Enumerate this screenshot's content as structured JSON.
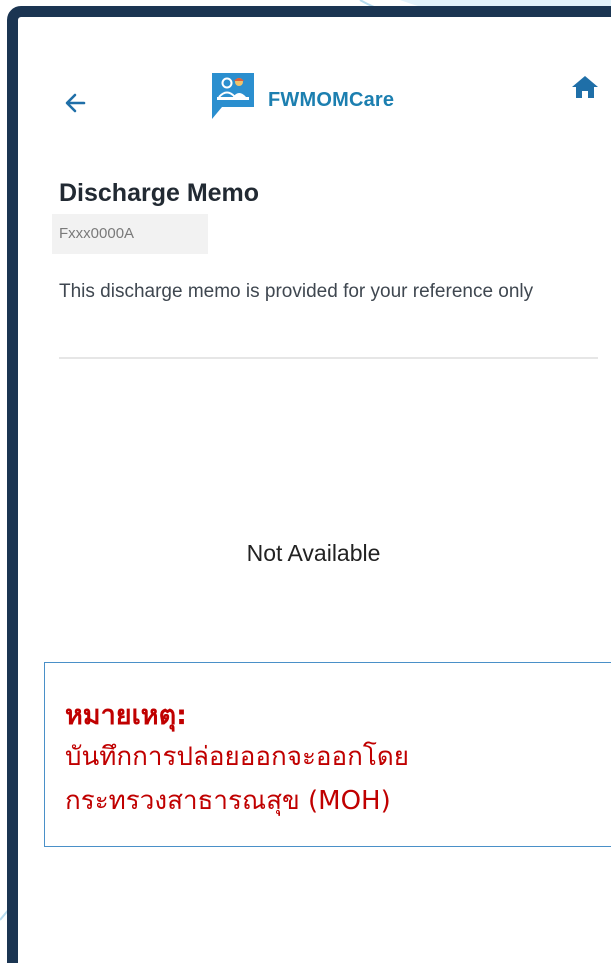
{
  "header": {
    "back_icon": "arrow-left-icon",
    "brand_name": "FWMOMCare",
    "home_icon": "home-icon"
  },
  "page": {
    "title": "Discharge Memo",
    "id_value": "Fxxx0000A",
    "info_text": "This discharge memo is provided for your reference only",
    "empty_state": "Not Available"
  },
  "note": {
    "title": "หมายเหตุ:",
    "body_line1": "บันทึกการปล่อยออกจะออกโดย",
    "body_line2": "กระทรวงสาธารณสุข (MOH)"
  },
  "colors": {
    "brand": "#1c7fb0",
    "frame": "#1b3552",
    "note_text": "#c00000",
    "note_border": "#4a90c8"
  }
}
